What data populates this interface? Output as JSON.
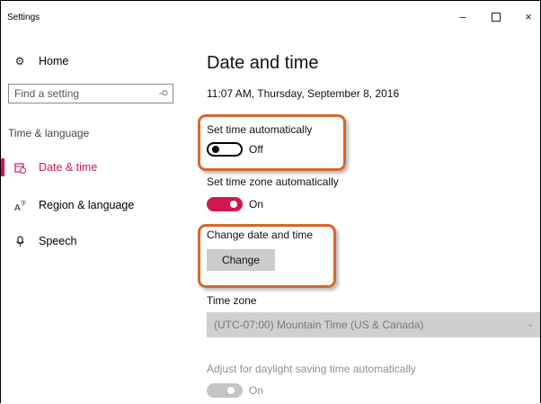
{
  "window": {
    "title": "Settings",
    "minimize_glyph": "–",
    "close_glyph": "×"
  },
  "sidebar": {
    "home": {
      "label": "Home",
      "icon": "gear-icon"
    },
    "search": {
      "placeholder": "Find a setting",
      "icon": "search-icon"
    },
    "section_label": "Time & language",
    "items": [
      {
        "label": "Date & time",
        "icon": "calendar-clock-icon",
        "active": true
      },
      {
        "label": "Region & language",
        "icon": "region-language-icon",
        "active": false
      },
      {
        "label": "Speech",
        "icon": "microphone-icon",
        "active": false
      }
    ]
  },
  "main": {
    "title": "Date and time",
    "current_time": "11:07 AM, Thursday, September 8, 2016",
    "set_time_auto": {
      "label": "Set time automatically",
      "state": "Off"
    },
    "set_timezone_auto": {
      "label": "Set time zone automatically",
      "state": "On"
    },
    "change_date_time": {
      "label": "Change date and time",
      "button": "Change"
    },
    "time_zone": {
      "label": "Time zone",
      "value": "(UTC-07:00) Mountain Time (US & Canada)"
    },
    "daylight": {
      "label": "Adjust for daylight saving time automatically",
      "state": "On"
    }
  },
  "colors": {
    "accent": "#d0174f",
    "highlight": "#d9662a",
    "disabled": "#c4c4c4"
  }
}
